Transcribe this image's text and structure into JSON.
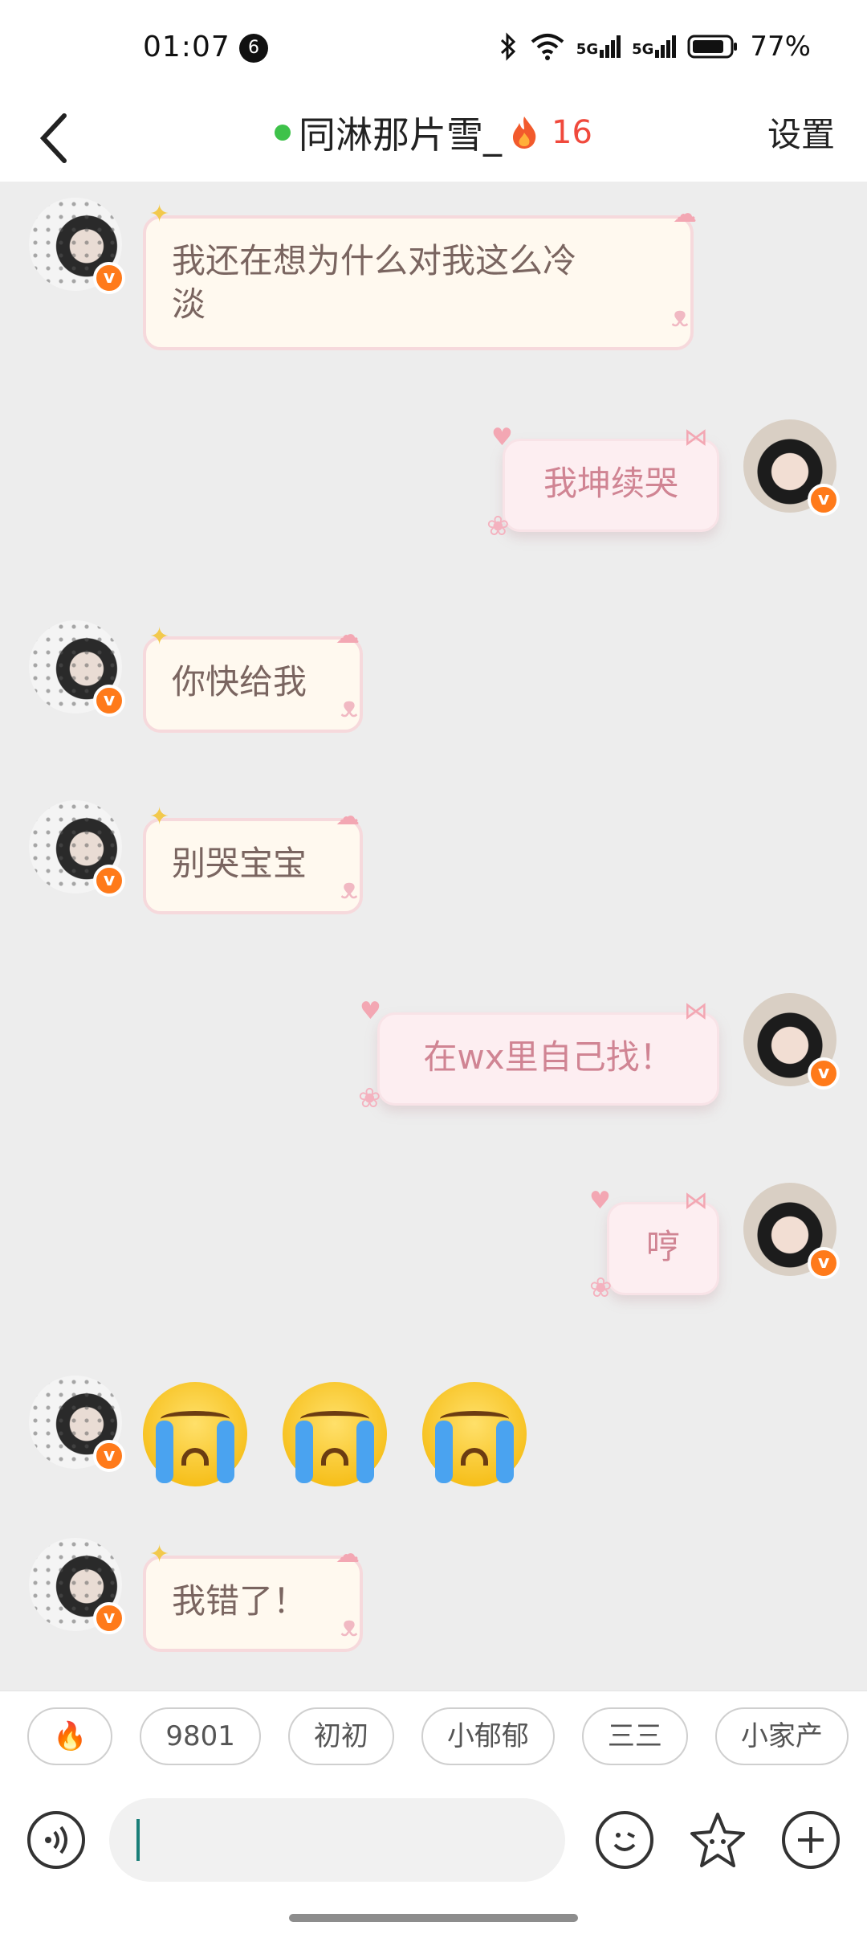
{
  "status_bar": {
    "time": "01:07",
    "notification_count": "6",
    "battery": "77%",
    "signal_1": "5G",
    "signal_2": "5G"
  },
  "header": {
    "title": "同淋那片雪_",
    "streak_count": "16",
    "settings_label": "设置",
    "online_color": "#3ec24a"
  },
  "messages": [
    {
      "side": "left",
      "text_line1": "我还在想为什么对我这么冷",
      "text_line2": "淡"
    },
    {
      "side": "right",
      "text": "我坤续哭"
    },
    {
      "side": "left",
      "text": "你快给我"
    },
    {
      "side": "left",
      "text": "别哭宝宝"
    },
    {
      "side": "right",
      "text": "在wx里自己找！"
    },
    {
      "side": "right",
      "text": "哼"
    },
    {
      "side": "left",
      "type": "emoji",
      "emoji": "loudly-crying-face",
      "count": 3
    },
    {
      "side": "left",
      "text": "我错了！"
    }
  ],
  "quick_replies": [
    "🔥",
    "9801",
    "初初",
    "小郁郁",
    "三三",
    "小家产"
  ],
  "input": {
    "placeholder": "",
    "value": ""
  },
  "icons": {
    "voice": "voice-icon",
    "emoji": "emoji-icon",
    "sticker": "sticker-icon",
    "plus": "plus-icon"
  },
  "colors": {
    "left_bubble": "#fff9ef",
    "right_bubble": "#fdeef1",
    "right_text": "#d08493",
    "badge": "#ff7a1a"
  }
}
